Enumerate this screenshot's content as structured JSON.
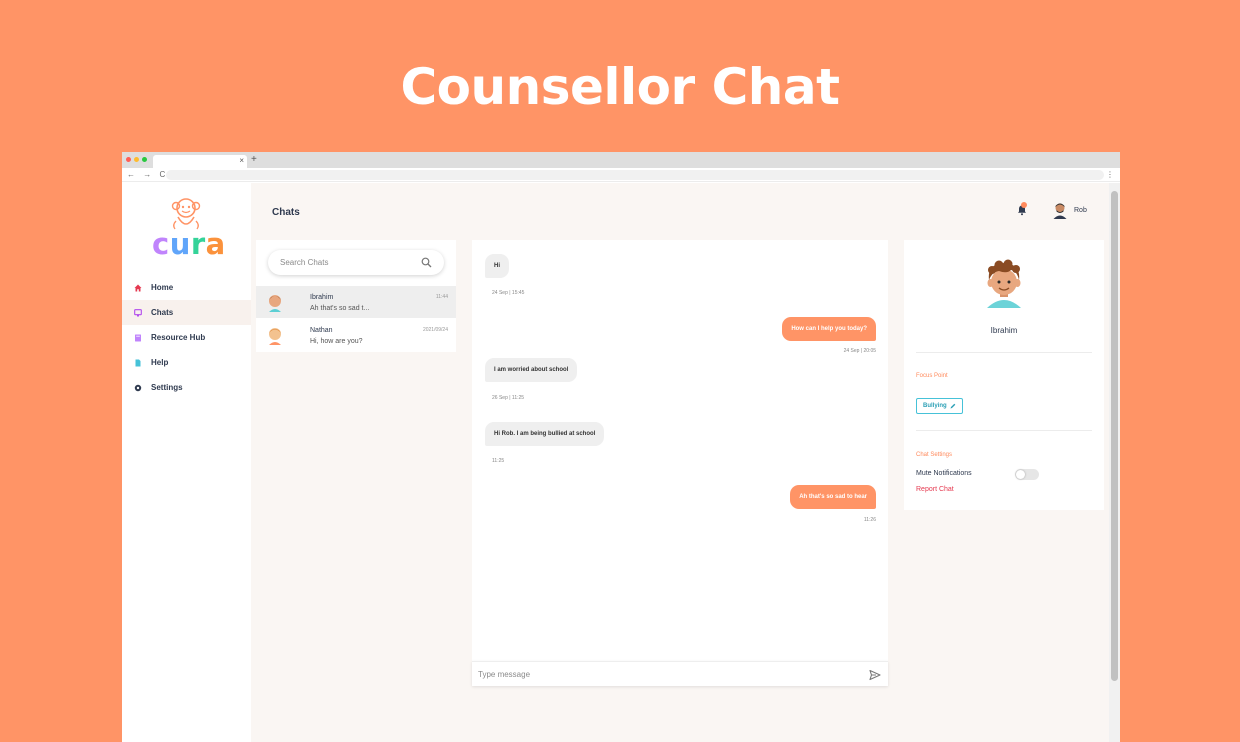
{
  "hero": {
    "title": "Counsellor Chat"
  },
  "browser": {
    "tab_close": "×",
    "new_tab": "+",
    "nav_buttons": "← → C",
    "menu": "⋮"
  },
  "sidebar": {
    "logo_text": [
      "c",
      "u",
      "r",
      "a"
    ],
    "logo_colors": [
      "#c084fc",
      "#60a5fa",
      "#34d399",
      "#fb923c"
    ],
    "items": [
      {
        "label": "Home",
        "icon": "home-icon",
        "color": "#e53950"
      },
      {
        "label": "Chats",
        "icon": "chat-monitor-icon",
        "color": "#b14aed"
      },
      {
        "label": "Resource Hub",
        "icon": "book-icon",
        "color": "#c084fc"
      },
      {
        "label": "Help",
        "icon": "document-icon",
        "color": "#46c2d8"
      },
      {
        "label": "Settings",
        "icon": "gear-icon",
        "color": "#2f3a4f"
      }
    ]
  },
  "topbar": {
    "title": "Chats",
    "user_name": "Rob"
  },
  "chat_list": {
    "search_placeholder": "Search Chats",
    "chats": [
      {
        "name": "Ibrahim",
        "preview": "Ah that's so sad t...",
        "time": "11:44",
        "active": true
      },
      {
        "name": "Nathan",
        "preview": "Hi, how are you?",
        "time": "2021/09/24",
        "active": false
      }
    ]
  },
  "conversation": {
    "messages": [
      {
        "text": "Hi",
        "direction": "in",
        "stamp": "24 Sep | 15:45"
      },
      {
        "text": "How can I help you today?",
        "direction": "out",
        "stamp": "24 Sep | 20:05"
      },
      {
        "text": "I am worried about school",
        "direction": "in",
        "stamp": "26 Sep | 11:25"
      },
      {
        "text": "Hi Rob. I am being bullied at school",
        "direction": "in",
        "stamp": "11:25"
      },
      {
        "text": "Ah that's so sad to hear",
        "direction": "out",
        "stamp": "11:26"
      }
    ],
    "composer_placeholder": "Type message"
  },
  "profile": {
    "name": "Ibrahim",
    "focus_label": "Focus Point",
    "focus_tag": "Bullying",
    "chat_settings_label": "Chat Settings",
    "mute_label": "Mute Notifications",
    "mute_enabled": false,
    "report_label": "Report Chat"
  },
  "colors": {
    "brand_orange": "#ff9466",
    "accent_teal": "#46c2d8",
    "danger": "#e53950",
    "text_dark": "#2f3a4f"
  }
}
